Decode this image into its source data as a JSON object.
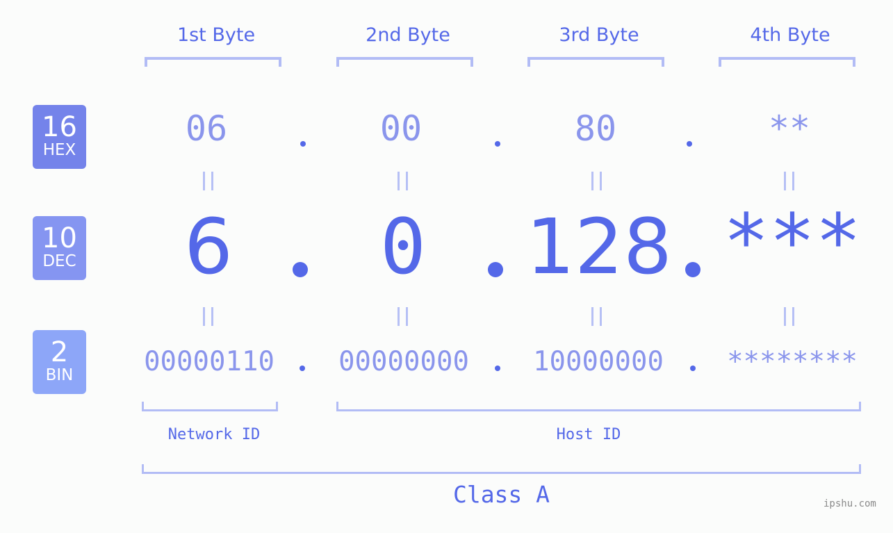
{
  "bytes": [
    {
      "label": "1st Byte",
      "hex": "06",
      "dec": "6",
      "bin": "00000110"
    },
    {
      "label": "2nd Byte",
      "hex": "00",
      "dec": "0",
      "bin": "00000000"
    },
    {
      "label": "3rd Byte",
      "hex": "80",
      "dec": "128",
      "bin": "10000000"
    },
    {
      "label": "4th Byte",
      "hex": "**",
      "dec": "***",
      "bin": "********"
    }
  ],
  "bases": {
    "hex": {
      "number": "16",
      "label": "HEX",
      "color": "#7483ea"
    },
    "dec": {
      "number": "10",
      "label": "DEC",
      "color": "#8595f1"
    },
    "bin": {
      "number": "2",
      "label": "BIN",
      "color": "#8da6f8"
    }
  },
  "network_id_label": "Network ID",
  "host_id_label": "Host ID",
  "class_label": "Class A",
  "watermark": "ipshu.com",
  "colors": {
    "accent": "#5468e8",
    "light_value": "#8a95ec",
    "bracket": "#b2bcf5",
    "background": "#fbfcfb"
  }
}
